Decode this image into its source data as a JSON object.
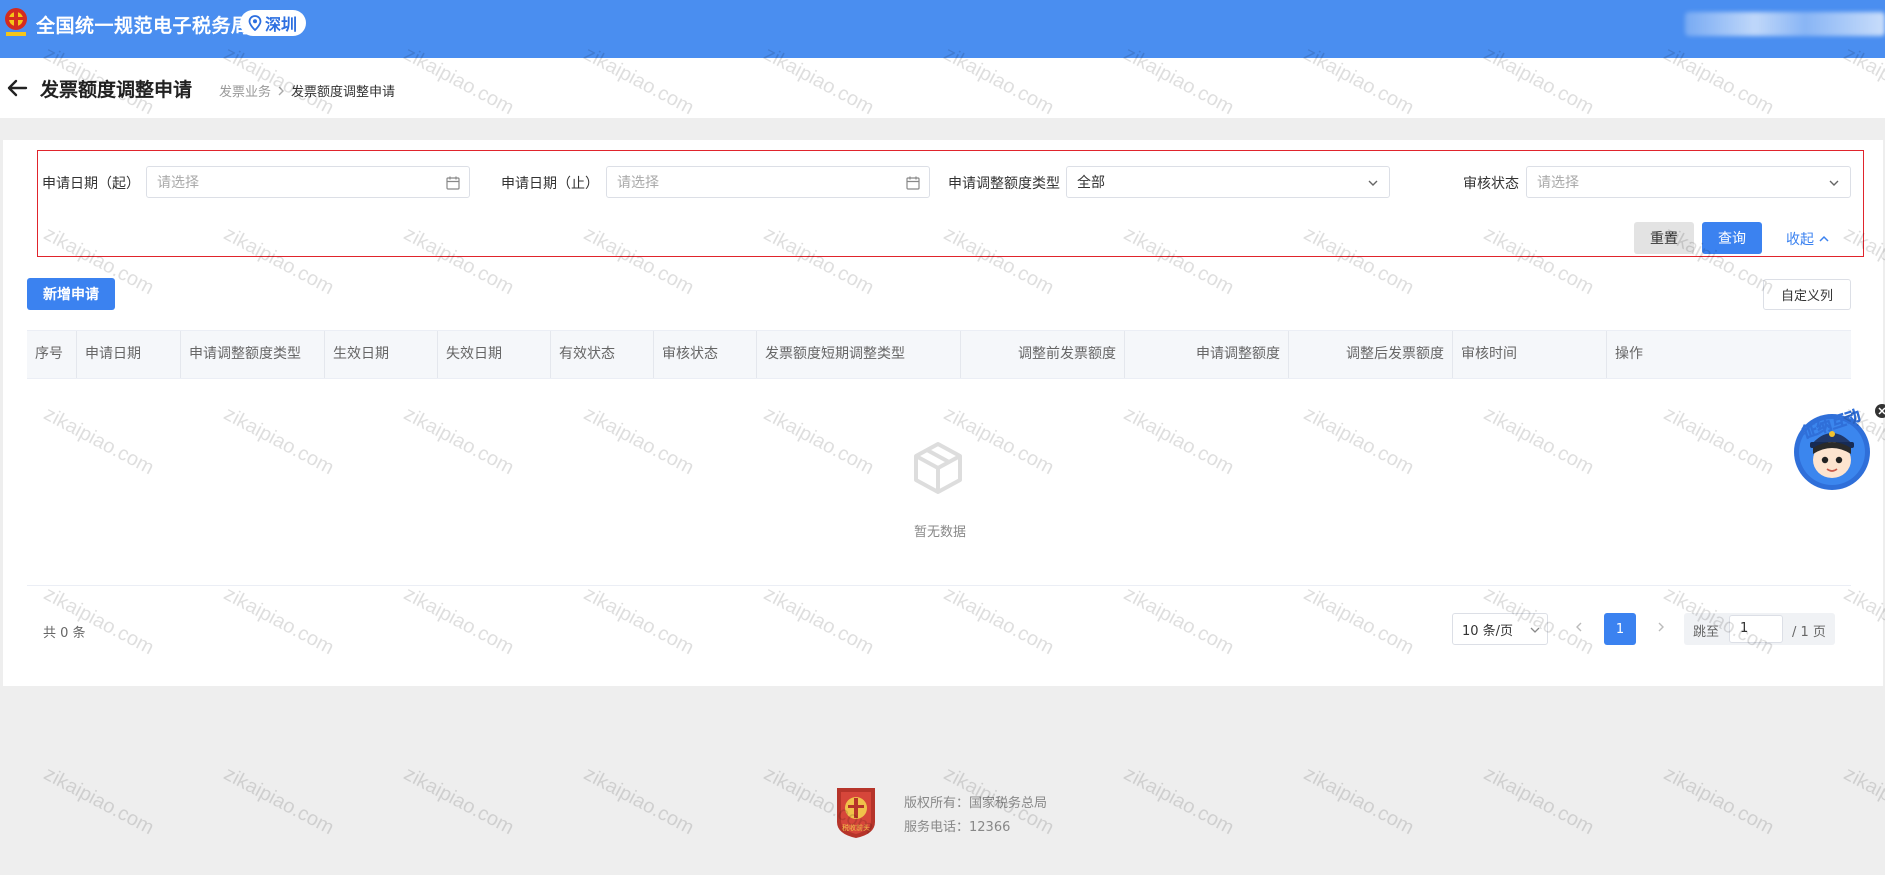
{
  "app": {
    "title": "全国统一规范电子税务局",
    "city": "深圳"
  },
  "page": {
    "title": "发票额度调整申请",
    "breadcrumb": [
      "发票业务",
      "发票额度调整申请"
    ]
  },
  "filters": {
    "start_date": {
      "label": "申请日期（起）",
      "placeholder": "请选择"
    },
    "end_date": {
      "label": "申请日期（止）",
      "placeholder": "请选择"
    },
    "adjust_type": {
      "label": "申请调整额度类型",
      "value": "全部"
    },
    "review_status": {
      "label": "审核状态",
      "placeholder": "请选择"
    },
    "reset_label": "重置",
    "query_label": "查询",
    "collapse_label": "收起"
  },
  "toolbar": {
    "new_label": "新增申请",
    "columns_label": "自定义列"
  },
  "table": {
    "columns": [
      "序号",
      "申请日期",
      "申请调整额度类型",
      "生效日期",
      "失效日期",
      "有效状态",
      "审核状态",
      "发票额度短期调整类型",
      "调整前发票额度",
      "申请调整额度",
      "调整后发票额度",
      "审核时间",
      "操作"
    ],
    "empty_text": "暂无数据"
  },
  "pagination": {
    "total_text": "共 0 条",
    "page_size": "10 条/页",
    "current_page": "1",
    "jump_label": "跳至",
    "jump_value": "1",
    "total_pages": "/ 1 页"
  },
  "helper": {
    "label": "征纳互动"
  },
  "footer": {
    "copyright": "版权所有：国家税务总局",
    "phone": "服务电话：12366",
    "logo_text": "税收前头"
  },
  "watermark": "zikaipiao.com",
  "colors": {
    "primary": "#3b82f0",
    "topbar": "#4a8ef0",
    "highlight_border": "#e0242c"
  }
}
